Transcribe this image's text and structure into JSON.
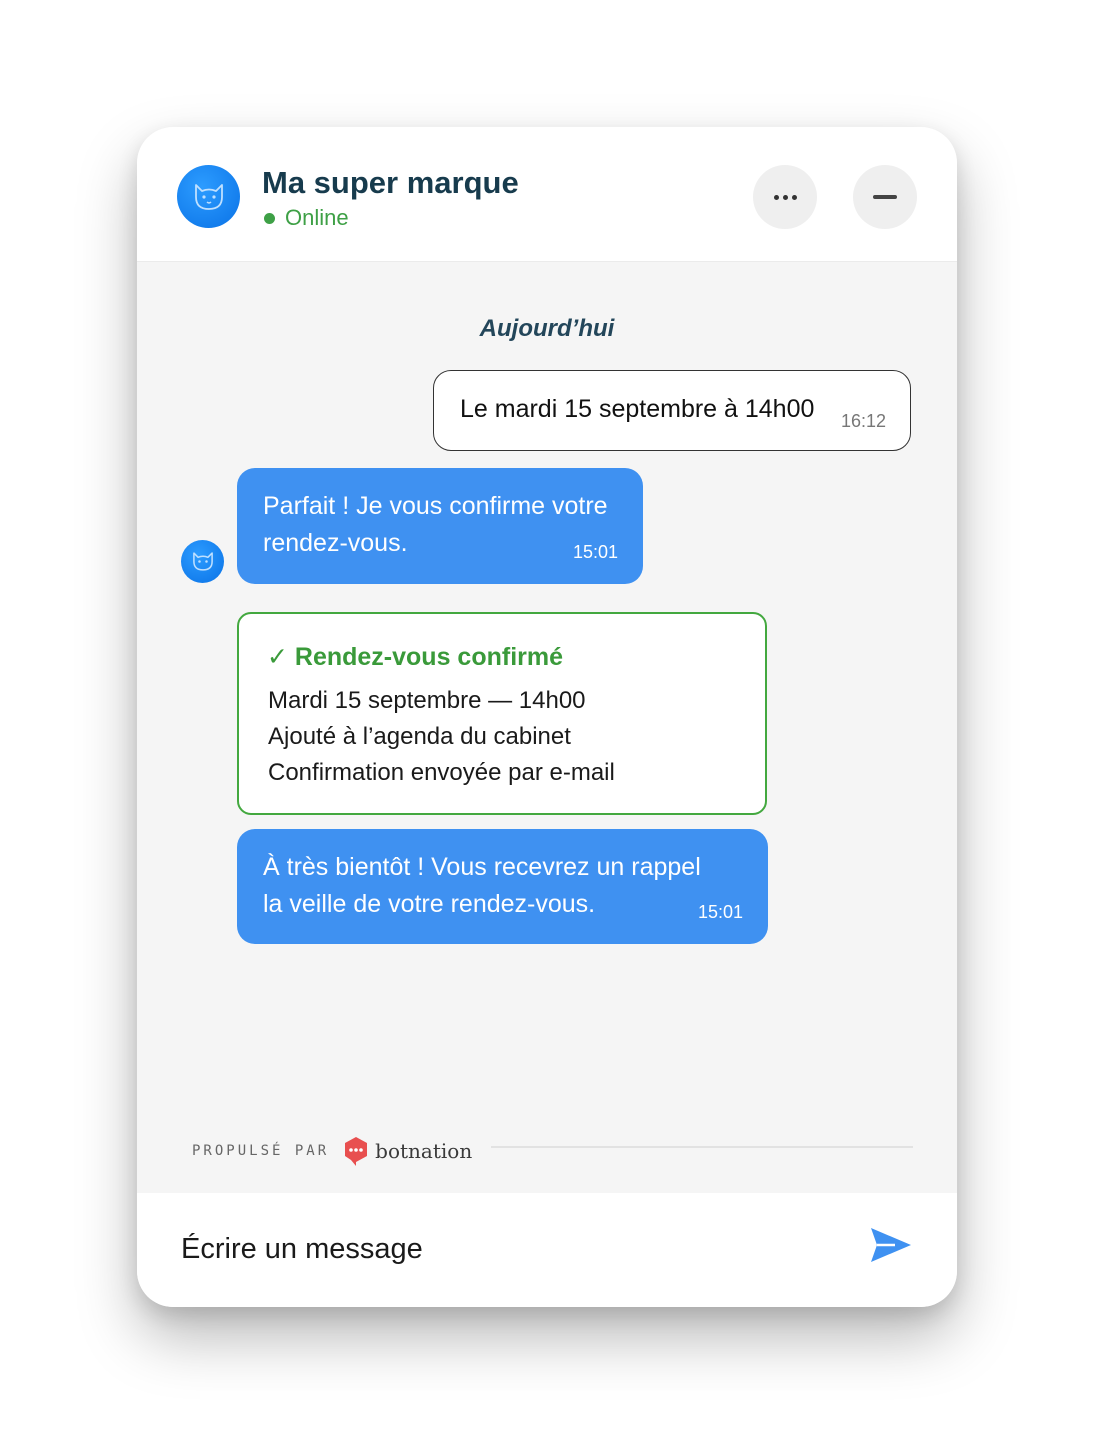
{
  "header": {
    "title": "Ma super marque",
    "status": "Online",
    "avatar_icon": "cat-face-icon",
    "more_icon": "more-horizontal-icon",
    "minimize_icon": "minimize-icon"
  },
  "conversation": {
    "day_label": "Aujourd’hui",
    "messages": [
      {
        "sender": "user",
        "text": "Le mardi 15 septembre à 14h00",
        "time": "16:12"
      },
      {
        "sender": "bot",
        "text": "Parfait ! Je vous confirme votre rendez-vous.",
        "time": "15:01"
      },
      {
        "sender": "bot",
        "text": "À très bientôt ! Vous recevrez un rappel la veille de votre rendez-vous.",
        "time": "15:01"
      }
    ],
    "confirmation_card": {
      "title": "✓ Rendez-vous confirmé",
      "lines": [
        "Mardi 15 septembre — 14h00",
        "Ajouté à l’agenda du cabinet",
        "Confirmation envoyée par e-mail"
      ]
    }
  },
  "footer": {
    "powered_by": "PROPULSÉ PAR",
    "brand": "botnation"
  },
  "composer": {
    "placeholder": "Écrire un message",
    "send_icon": "send-icon"
  },
  "colors": {
    "accent": "#3f91f1",
    "online": "#3ea046",
    "confirm": "#43a83f",
    "title": "#173b4d",
    "logo": "#e84f4f"
  }
}
